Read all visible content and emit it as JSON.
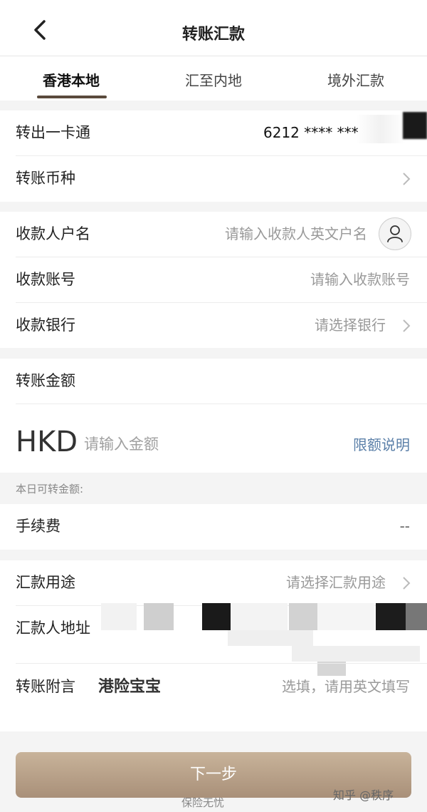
{
  "header": {
    "title": "转账汇款",
    "back_icon": "chevron-left-icon"
  },
  "tabs": [
    {
      "label": "香港本地",
      "active": true
    },
    {
      "label": "汇至内地",
      "active": false
    },
    {
      "label": "境外汇款",
      "active": false
    }
  ],
  "transfer_out": {
    "label": "转出一卡通",
    "value": "6212 **** ***"
  },
  "currency": {
    "label": "转账币种"
  },
  "payee_name": {
    "label": "收款人户名",
    "placeholder": "请输入收款人英文户名",
    "icon": "person-icon"
  },
  "payee_account": {
    "label": "收款账号",
    "placeholder": "请输入收款账号"
  },
  "payee_bank": {
    "label": "收款银行",
    "placeholder": "请选择银行"
  },
  "amount": {
    "label": "转账金额",
    "currency_code": "HKD",
    "placeholder": "请输入金额",
    "limit_link": "限额说明",
    "available_note": "本日可转金额:"
  },
  "fee": {
    "label": "手续费",
    "value": "--"
  },
  "purpose": {
    "label": "汇款用途",
    "placeholder": "请选择汇款用途"
  },
  "remitter_address": {
    "label": "汇款人地址"
  },
  "memo": {
    "label": "转账附言",
    "value": "港险宝宝",
    "placeholder": "选填，请用英文填写"
  },
  "submit": {
    "label": "下一步"
  },
  "watermarks": {
    "left": "保险无忧",
    "right": "知乎 @秩序"
  },
  "colors": {
    "accent_button": "#b9a38c",
    "link": "#5a7fa8",
    "tab_underline": "#5a4a3c"
  }
}
